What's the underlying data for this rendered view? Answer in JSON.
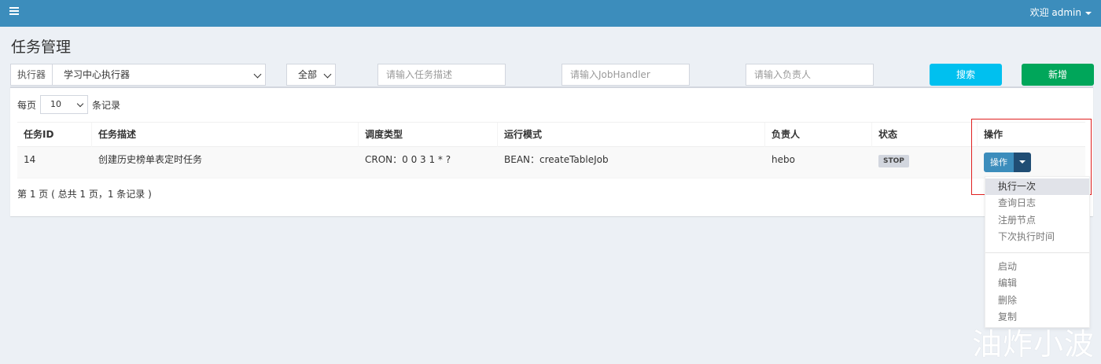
{
  "topbar": {
    "user_label": "欢迎 admin"
  },
  "page": {
    "title": "任务管理"
  },
  "filters": {
    "executor_label": "执行器",
    "executor_value": "学习中心执行器",
    "status_value": "全部",
    "desc_placeholder": "请输入任务描述",
    "handler_placeholder": "请输入JobHandler",
    "author_placeholder": "请输入负责人",
    "search_label": "搜索",
    "add_label": "新增"
  },
  "table": {
    "pagesize_prefix": "每页",
    "pagesize_value": "10",
    "pagesize_suffix": "条记录",
    "columns": [
      "任务ID",
      "任务描述",
      "调度类型",
      "运行模式",
      "负责人",
      "状态",
      "操作"
    ],
    "rows": [
      {
        "id": "14",
        "desc": "创建历史榜单表定时任务",
        "schedule": "CRON：0 0 3 1 * ?",
        "mode": "BEAN：createTableJob",
        "author": "hebo",
        "status": "STOP",
        "op_label": "操作"
      }
    ],
    "page_info": "第 1 页 ( 总共 1 页，1 条记录 )"
  },
  "dropdown": {
    "items": [
      "执行一次",
      "查询日志",
      "注册节点",
      "下次执行时间",
      "启动",
      "编辑",
      "删除",
      "复制"
    ]
  },
  "watermark": "油炸小波",
  "colors": {
    "topbar": "#3c8dbc",
    "search": "#00c0ef",
    "add": "#00a65a",
    "op_button": "#3c8dbc",
    "highlight": "#e02020"
  }
}
